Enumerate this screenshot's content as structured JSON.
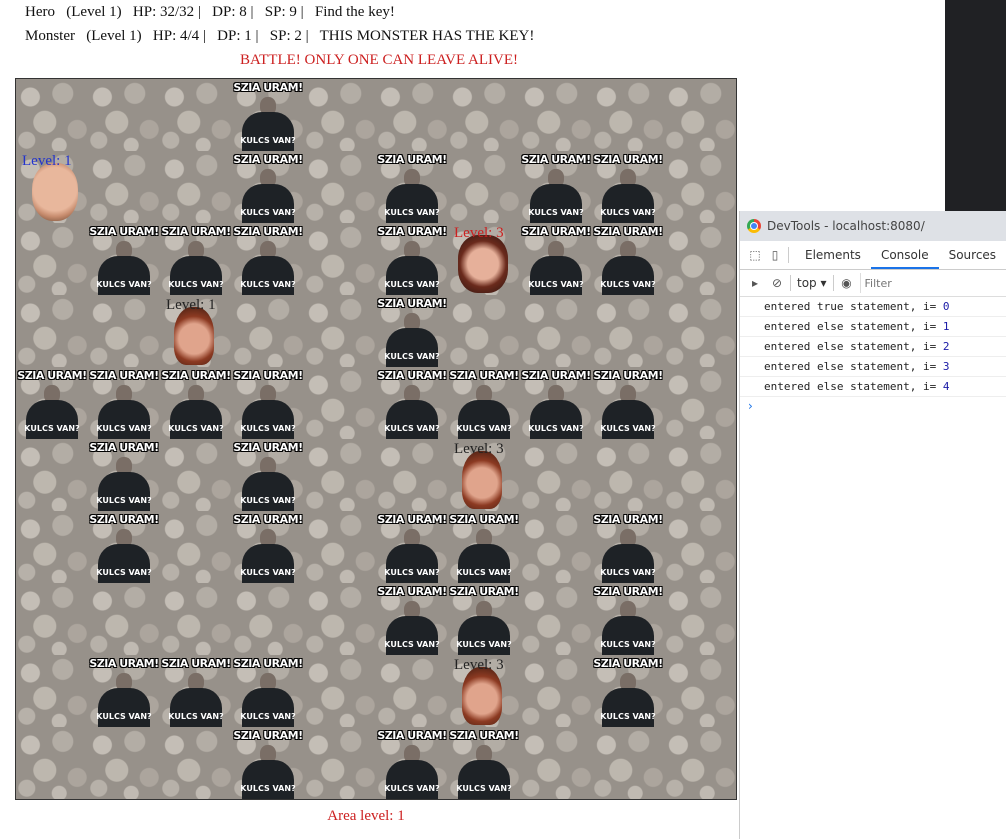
{
  "hud": {
    "hero": [
      "Hero",
      "(Level 1)",
      "HP: 32/32 |",
      "DP: 8 |",
      "SP: 9 |",
      "Find the key!"
    ],
    "monster": [
      "Monster",
      "(Level 1)",
      "HP: 4/4 |",
      "DP: 1 |",
      "SP: 2 |",
      "THIS MONSTER HAS THE KEY!"
    ],
    "battle": "BATTLE! ONLY ONE CAN LEAVE ALIVE!",
    "area": "Area level: 1"
  },
  "board": {
    "grid_size": 10,
    "wall_top_text": "SZIA URAM!",
    "wall_bottom_text": "KULCS VAN?",
    "walls": [
      [
        0,
        3
      ],
      [
        1,
        3
      ],
      [
        1,
        5
      ],
      [
        1,
        7
      ],
      [
        1,
        8
      ],
      [
        2,
        1
      ],
      [
        2,
        2
      ],
      [
        2,
        3
      ],
      [
        2,
        5
      ],
      [
        2,
        7
      ],
      [
        2,
        8
      ],
      [
        3,
        5
      ],
      [
        4,
        0
      ],
      [
        4,
        1
      ],
      [
        4,
        2
      ],
      [
        4,
        3
      ],
      [
        4,
        5
      ],
      [
        4,
        6
      ],
      [
        4,
        7
      ],
      [
        4,
        8
      ],
      [
        5,
        1
      ],
      [
        5,
        3
      ],
      [
        6,
        1
      ],
      [
        6,
        3
      ],
      [
        6,
        5
      ],
      [
        6,
        6
      ],
      [
        6,
        8
      ],
      [
        7,
        5
      ],
      [
        7,
        6
      ],
      [
        7,
        8
      ],
      [
        8,
        1
      ],
      [
        8,
        2
      ],
      [
        8,
        3
      ],
      [
        8,
        8
      ],
      [
        9,
        3
      ],
      [
        9,
        5
      ],
      [
        9,
        6
      ]
    ],
    "hero": {
      "row": 1,
      "col": 0,
      "label": "Level: 1"
    },
    "monsters": [
      {
        "row": 3,
        "col": 2,
        "label": "Level: 1"
      },
      {
        "row": 5,
        "col": 6,
        "label": "Level: 3"
      },
      {
        "row": 8,
        "col": 6,
        "label": "Level: 3"
      }
    ],
    "boss": {
      "row": 2,
      "col": 6,
      "label": "Level: 3"
    }
  },
  "devtools": {
    "title": "DevTools - localhost:8080/",
    "tabs": [
      "Elements",
      "Console",
      "Sources"
    ],
    "active_tab": "Console",
    "context": "top",
    "filter_placeholder": "Filter",
    "logs": [
      {
        "text": "entered true statement, i= ",
        "num": "0"
      },
      {
        "text": "entered else statement, i= ",
        "num": "1"
      },
      {
        "text": "entered else statement, i= ",
        "num": "2"
      },
      {
        "text": "entered else statement, i= ",
        "num": "3"
      },
      {
        "text": "entered else statement, i= ",
        "num": "4"
      }
    ],
    "prompt": "›"
  }
}
